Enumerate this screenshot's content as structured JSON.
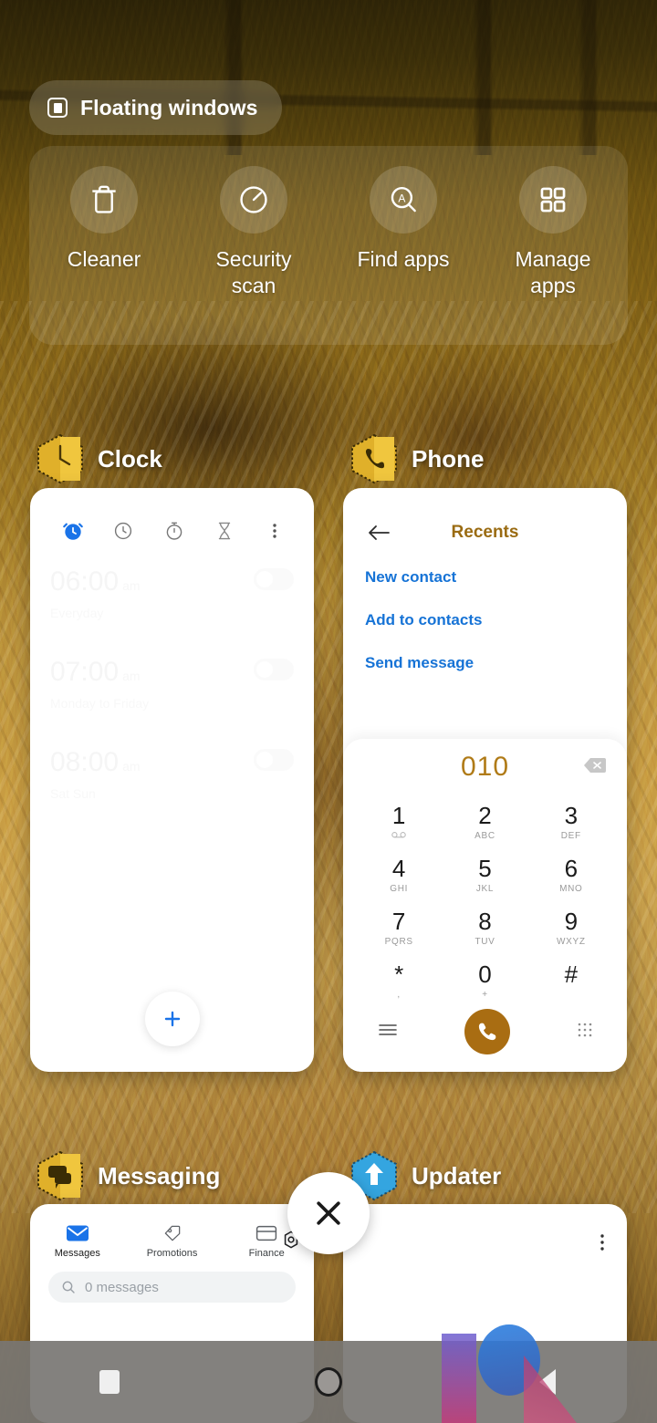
{
  "floating_windows": {
    "label": "Floating windows",
    "icon": "floating-window-icon"
  },
  "quick_actions": [
    {
      "label": "Cleaner",
      "icon": "trash-icon"
    },
    {
      "label": "Security\nscan",
      "label_line1": "Security",
      "label_line2": "scan",
      "icon": "speedometer-icon"
    },
    {
      "label": "Find apps",
      "icon": "search-a-icon"
    },
    {
      "label": "Manage\napps",
      "label_line1": "Manage",
      "label_line2": "apps",
      "icon": "grid-apps-icon"
    }
  ],
  "apps": {
    "clock": {
      "name": "Clock",
      "icon": "clock-app-icon",
      "tabs": [
        {
          "name": "alarm-tab",
          "icon": "alarm-clock-icon",
          "active": true
        },
        {
          "name": "world-clock-tab",
          "icon": "clock-icon",
          "active": false
        },
        {
          "name": "stopwatch-tab",
          "icon": "stopwatch-icon",
          "active": false
        },
        {
          "name": "timer-tab",
          "icon": "hourglass-icon",
          "active": false
        },
        {
          "name": "overflow-menu",
          "icon": "more-vertical-icon",
          "active": false
        }
      ],
      "alarms": [
        {
          "time": "06:00",
          "meridiem": "am",
          "days": "Everyday",
          "enabled": false
        },
        {
          "time": "07:00",
          "meridiem": "am",
          "days": "Monday to Friday",
          "enabled": false
        },
        {
          "time": "08:00",
          "meridiem": "am",
          "days": "Sat Sun",
          "enabled": false
        }
      ],
      "fab": {
        "icon": "plus-icon",
        "color": "#1a73e8"
      }
    },
    "phone": {
      "name": "Phone",
      "icon": "phone-app-icon",
      "back_icon": "arrow-left-icon",
      "title": "Recents",
      "title_color": "#9a6b12",
      "links": [
        {
          "label": "New contact"
        },
        {
          "label": "Add to contacts"
        },
        {
          "label": "Send message"
        }
      ],
      "dialpad": {
        "number": "010",
        "number_color": "#b07b18",
        "backspace_icon": "backspace-icon",
        "keys": [
          {
            "digit": "1",
            "sub": "",
            "sub_icon": "voicemail-icon"
          },
          {
            "digit": "2",
            "sub": "ABC"
          },
          {
            "digit": "3",
            "sub": "DEF"
          },
          {
            "digit": "4",
            "sub": "GHI"
          },
          {
            "digit": "5",
            "sub": "JKL"
          },
          {
            "digit": "6",
            "sub": "MNO"
          },
          {
            "digit": "7",
            "sub": "PQRS"
          },
          {
            "digit": "8",
            "sub": "TUV"
          },
          {
            "digit": "9",
            "sub": "WXYZ"
          },
          {
            "digit": "*",
            "sub": ","
          },
          {
            "digit": "0",
            "sub": "+"
          },
          {
            "digit": "#",
            "sub": ""
          }
        ],
        "bottom": {
          "left_icon": "menu-lines-icon",
          "call_icon": "phone-handset-icon",
          "call_color": "#a96d12",
          "right_icon": "keypad-dots-icon"
        }
      }
    },
    "messaging": {
      "name": "Messaging",
      "icon": "messaging-app-icon",
      "tabs": [
        {
          "label": "Messages",
          "icon": "envelope-icon",
          "active": true
        },
        {
          "label": "Promotions",
          "icon": "tag-icon",
          "active": false
        },
        {
          "label": "Finance",
          "icon": "card-icon",
          "active": false
        }
      ],
      "settings_icon": "gear-icon",
      "search": {
        "icon": "search-icon",
        "placeholder": "0 messages",
        "value": ""
      }
    },
    "updater": {
      "name": "Updater",
      "icon": "updater-app-icon",
      "menu_icon": "more-vertical-icon"
    }
  },
  "close_button": {
    "icon": "close-icon"
  },
  "navbar": [
    {
      "name": "recents-button",
      "icon": "square-icon"
    },
    {
      "name": "home-button",
      "icon": "circle-icon"
    },
    {
      "name": "back-button",
      "icon": "triangle-left-icon"
    }
  ]
}
